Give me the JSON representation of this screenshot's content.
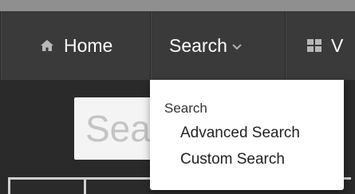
{
  "nav": {
    "home_label": "Home",
    "search_label": "Search",
    "partial_label": "V"
  },
  "search": {
    "placeholder": "Search"
  },
  "dropdown": {
    "header": "Search",
    "items": [
      {
        "label": "Advanced Search"
      },
      {
        "label": "Custom Search"
      }
    ]
  },
  "icons": {
    "home": "home-icon",
    "search_menu": "chevron-down-icon",
    "grid": "grid-icon"
  },
  "colors": {
    "navbar": "#3a3a3a",
    "subbar": "#2a2a2a",
    "nav_text": "#ffffff",
    "dropdown_bg": "#ffffff"
  }
}
